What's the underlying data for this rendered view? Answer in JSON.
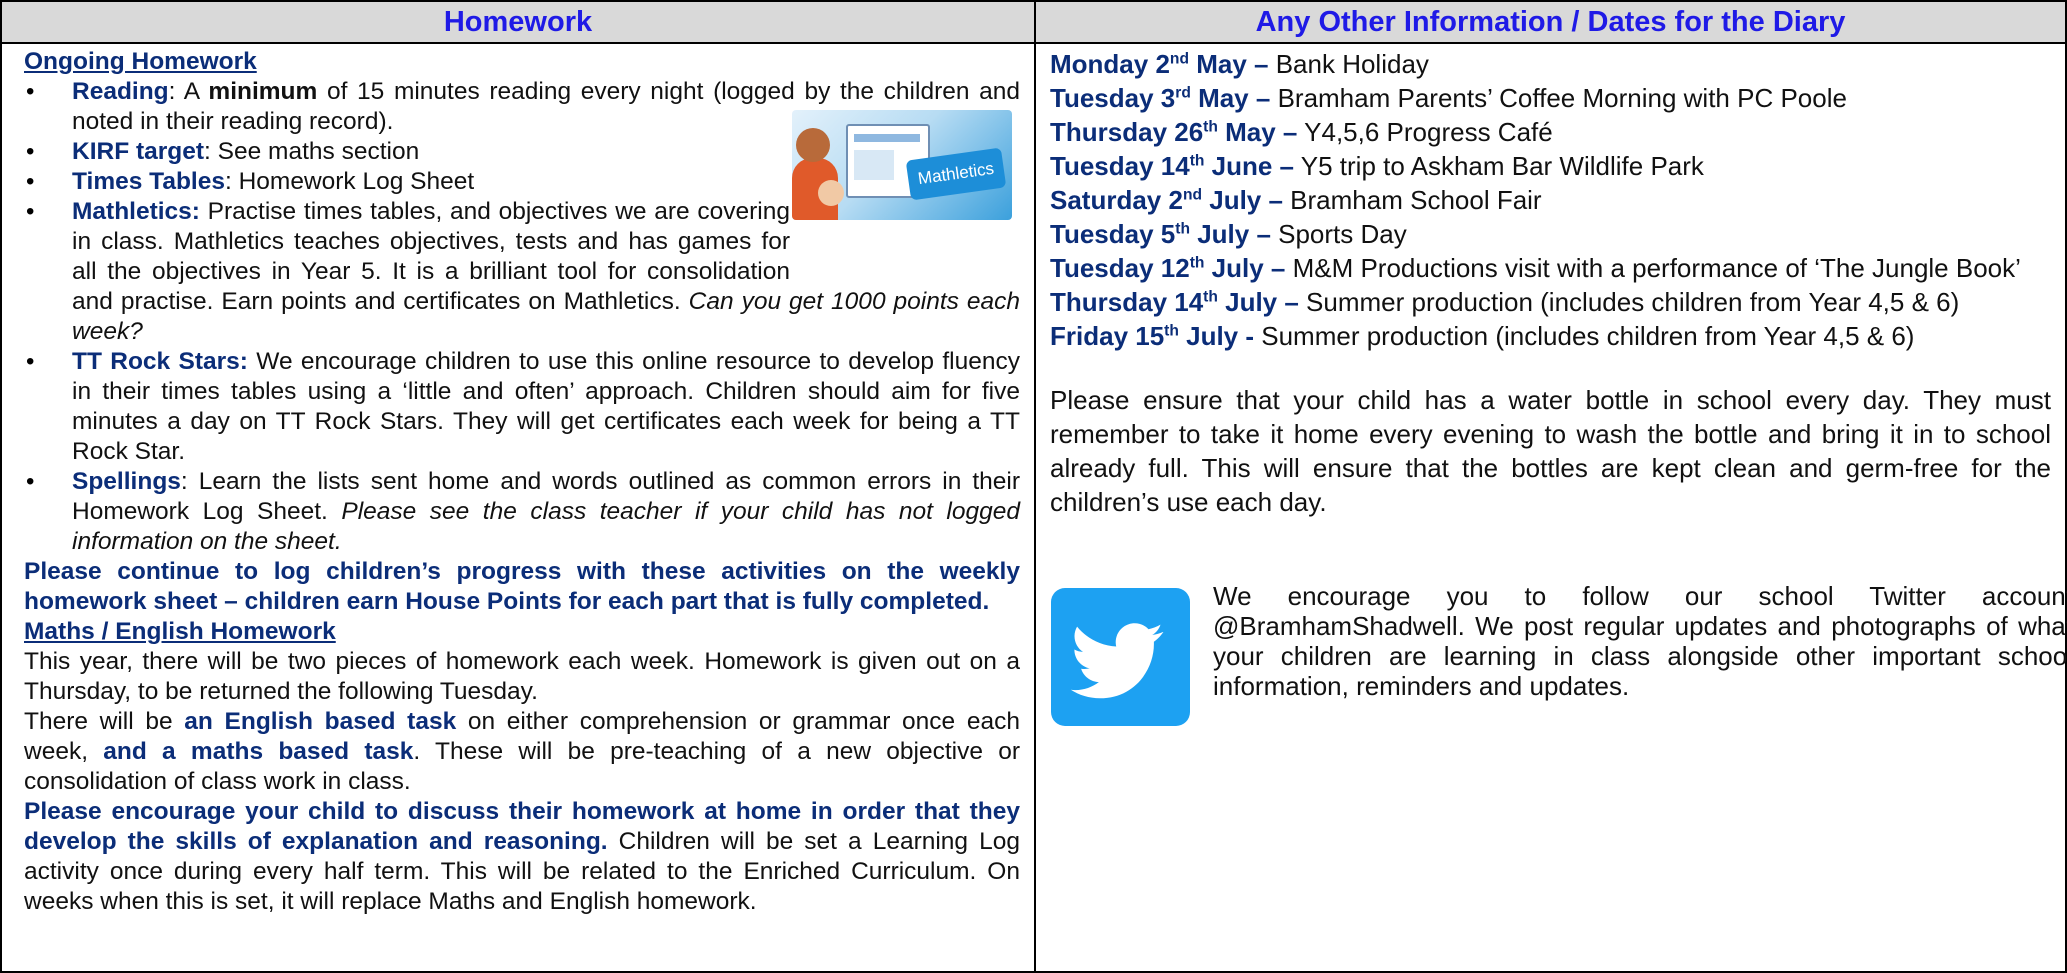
{
  "left": {
    "heading": "Homework",
    "ongoing_title": "Ongoing Homework",
    "bullets": [
      {
        "label": "Reading",
        "text_a": ": A ",
        "bold_mid": "minimum",
        "text_b": " of 15 minutes reading every night (logged by the children and noted in their reading record)."
      },
      {
        "label": "KIRF target",
        "text": ": See maths section"
      },
      {
        "label": "Times Tables",
        "text": ": Homework Log Sheet"
      },
      {
        "label": "Mathletics:",
        "text": " Practise times tables, and objectives we are covering in class. Mathletics teaches objectives, tests and has games for all the objectives in Year 5. It is a brilliant tool for consolidation and practise. Earn points and certificates on Mathletics. ",
        "italic": "Can you get 1000 points each week?"
      },
      {
        "label": "TT Rock Stars:",
        "text": " We encourage children to use this online resource to develop fluency in their times tables using a ‘little and often’ approach. Children should aim for five minutes a day on TT Rock Stars. They will get certificates each week for being a TT Rock Star."
      },
      {
        "label": "Spellings",
        "text": ": Learn the lists sent home and words outlined as common errors in their Homework Log Sheet. ",
        "italic": "Please see the class teacher if your child has not logged information on the sheet."
      }
    ],
    "log_note": "Please continue to log children’s progress with these activities on the weekly homework sheet – children earn House Points for each part that is fully completed.",
    "maths_title": "Maths / English Homework",
    "maths_p1": "This year, there will be two pieces of homework each week. Homework is given out on a Thursday, to be returned the following Tuesday.",
    "maths_p2_a": "There will be ",
    "maths_p2_b": "an English based task",
    "maths_p2_c": " on either comprehension or grammar once each week, ",
    "maths_p2_d": "and a maths based task",
    "maths_p2_e": ". These will be pre-teaching of a new objective or consolidation of class work in class.",
    "maths_p3_bold": "Please encourage your child to discuss their homework at home in order that they develop the skills of explanation and reasoning.",
    "maths_p3_rest": " Children will be set a Learning Log activity once during every half term.  This will be related to the Enriched Curriculum. On weeks when this is set, it will replace Maths and English homework.",
    "mathletics_image_text": "Mathletics"
  },
  "right": {
    "heading": "Any Other Information / Dates for the Diary",
    "dates": [
      {
        "day": "Monday 2",
        "sup": "nd",
        "month": " May –",
        "event": " Bank Holiday"
      },
      {
        "day": "Tuesday 3",
        "sup": "rd",
        "month": " May –",
        "event": " Bramham Parents’ Coffee Morning with PC Poole"
      },
      {
        "day": "Thursday 26",
        "sup": "th",
        "month": " May –",
        "event": " Y4,5,6 Progress Café"
      },
      {
        "day": "Tuesday 14",
        "sup": "th",
        "month": " June –",
        "event": " Y5 trip to Askham Bar Wildlife Park"
      },
      {
        "day": "Saturday 2",
        "sup": "nd",
        "month": " July –",
        "event": " Bramham School Fair"
      },
      {
        "day": "Tuesday 5",
        "sup": "th",
        "month": " July –",
        "event": " Sports Day"
      },
      {
        "day": "Tuesday 12",
        "sup": "th",
        "month": " July –",
        "event": " M&M Productions visit with a performance of ‘The Jungle Book’"
      },
      {
        "day": "Thursday 14",
        "sup": "th",
        "month": " July –",
        "event": " Summer production (includes children from Year 4,5 & 6)"
      },
      {
        "day": "Friday 15",
        "sup": "th",
        "month": " July -",
        "event": " Summer production (includes children from Year 4,5 & 6)"
      }
    ],
    "water_note": "Please ensure that your child has a water bottle in school every day. They must remember to take it home every evening to wash the bottle and bring it in to school already full. This will ensure that the bottles are kept clean and germ-free for the children’s use each day.",
    "twitter_note": "We encourage you to follow our school Twitter account @BramhamShadwell. We post regular updates and photographs of what your children are learning in class alongside other important school information, reminders and updates."
  },
  "colors": {
    "heading_blue": "#1f1ae6",
    "navy": "#0b2d78",
    "header_bg": "#d9d9d9",
    "twitter_blue": "#1da1f2"
  }
}
